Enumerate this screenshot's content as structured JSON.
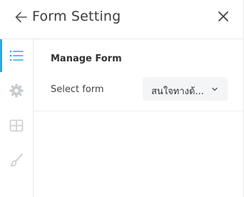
{
  "header": {
    "title": "Form Setting",
    "back_icon": "arrow-left-icon",
    "close_icon": "close-icon"
  },
  "rail": {
    "items": [
      {
        "icon": "list-icon",
        "active": true
      },
      {
        "icon": "gear-icon",
        "active": false
      },
      {
        "icon": "grid-icon",
        "active": false
      },
      {
        "icon": "brush-icon",
        "active": false
      }
    ]
  },
  "section": {
    "title": "Manage Form",
    "select_label": "Select form",
    "select_value": "สนใจทางด้...",
    "chevron_icon": "chevron-down-icon"
  },
  "colors": {
    "accent": "#29abe2",
    "inactive_icon": "#c9ccd1"
  }
}
